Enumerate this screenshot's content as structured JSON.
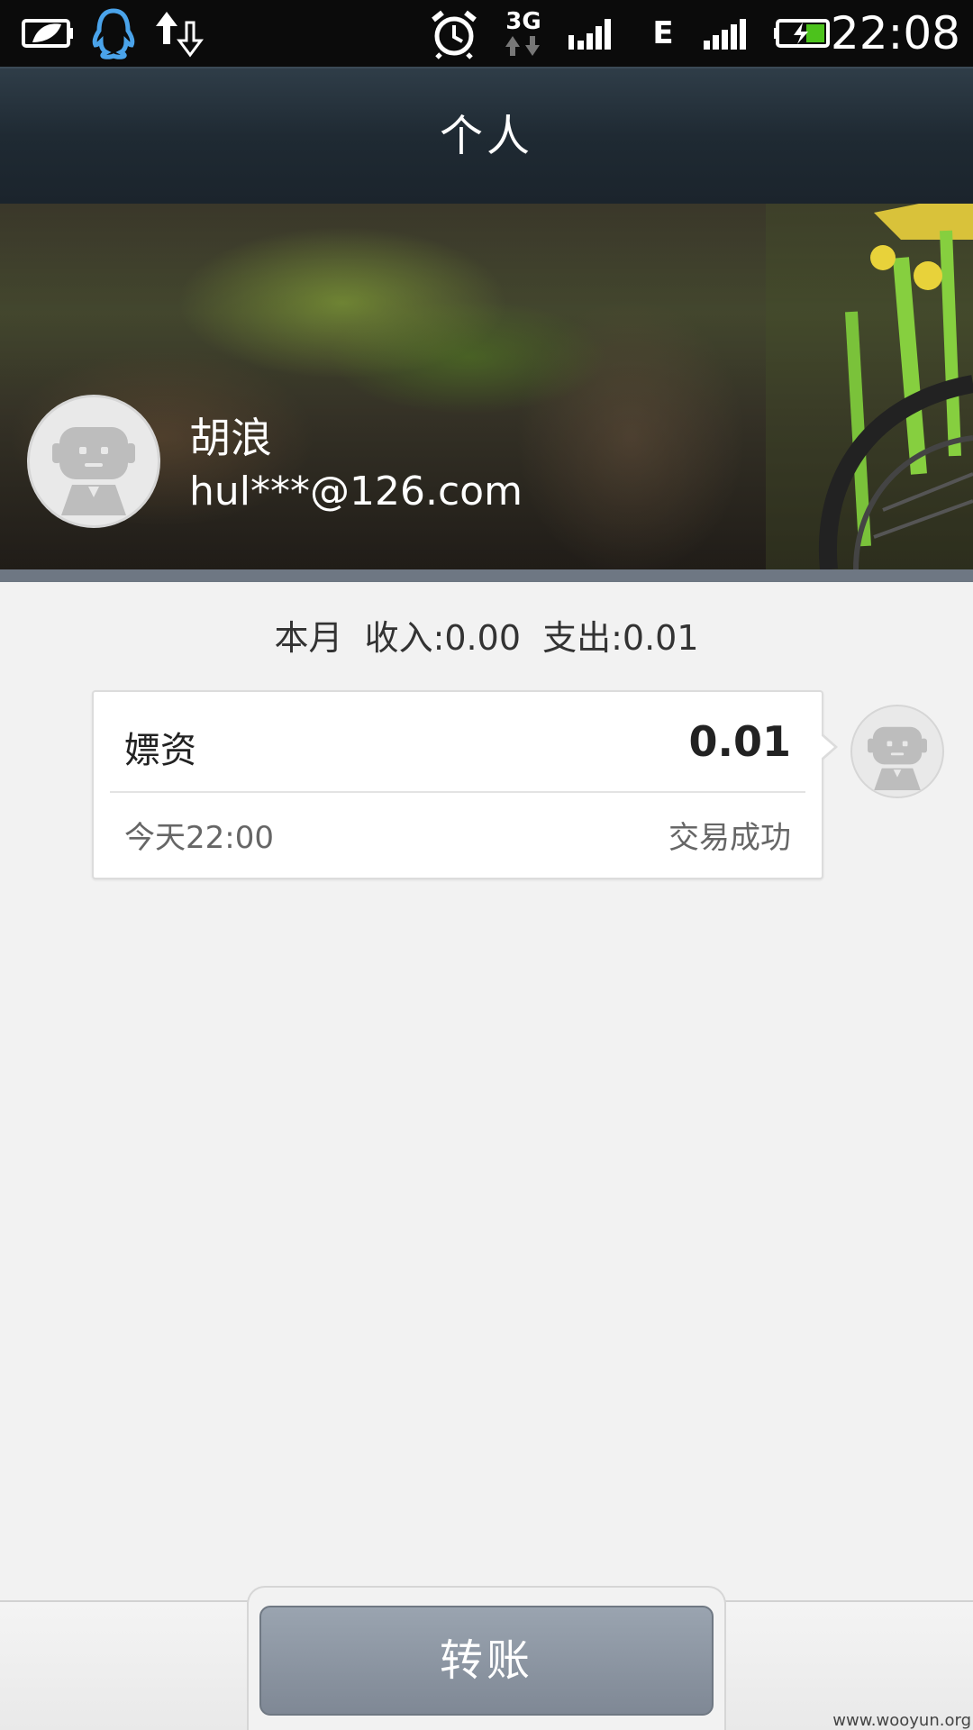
{
  "status_bar": {
    "time": "22:08",
    "network_label": "3G",
    "network_type": "E",
    "icons": [
      "leaf-battery-icon",
      "qq-icon",
      "upload-download-icon",
      "alarm-icon",
      "3g-icon",
      "signal-icon",
      "edge-icon",
      "signal-icon",
      "battery-charging-icon"
    ]
  },
  "header": {
    "title": "个人"
  },
  "profile": {
    "name": "胡浪",
    "email": "hul***@126.com"
  },
  "summary": {
    "month_label": "本月",
    "income": "收入:0.00",
    "expense": "支出:0.01"
  },
  "transactions": [
    {
      "title": "嫖资",
      "amount": "0.01",
      "time": "今天22:00",
      "status": "交易成功"
    }
  ],
  "footer": {
    "transfer_label": "转账"
  },
  "watermark": "www.wooyun.org",
  "colors": {
    "title_bar": "#1f2a33",
    "background": "#f2f2f2",
    "button": "#8a939f",
    "divider_band": "#6e7783"
  }
}
